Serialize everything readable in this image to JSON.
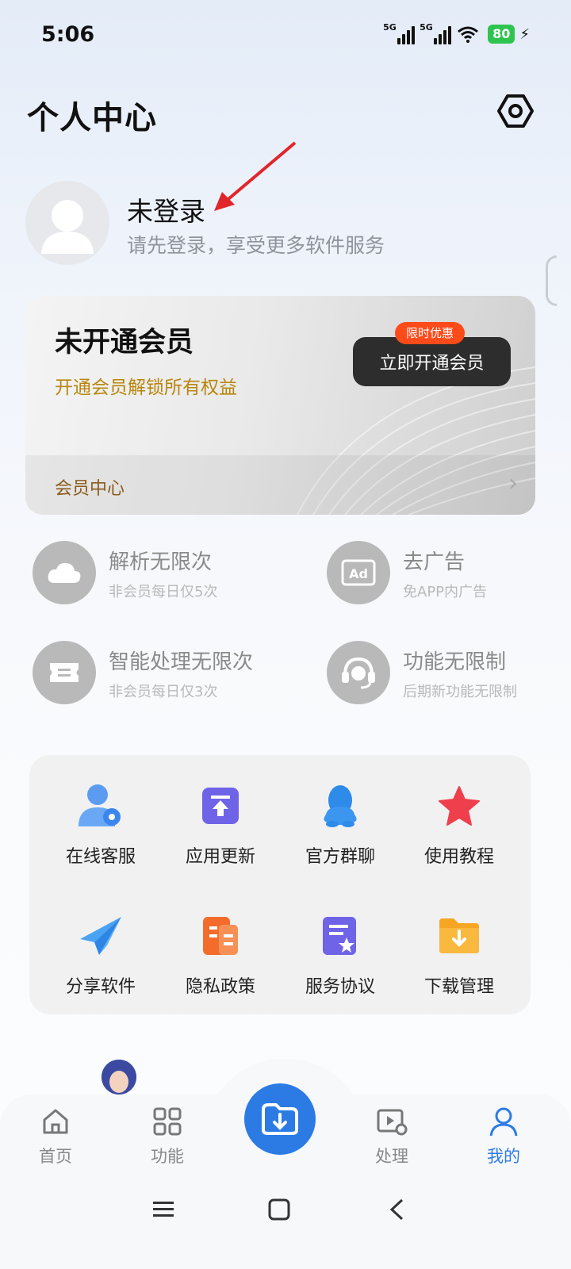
{
  "status": {
    "time": "5:06",
    "net1": "5G",
    "net2": "5G",
    "battery": "80"
  },
  "header": {
    "title": "个人中心"
  },
  "profile": {
    "name": "未登录",
    "subtitle": "请先登录，享受更多软件服务"
  },
  "vip": {
    "title": "未开通会员",
    "subtitle": "开通会员解锁所有权益",
    "badge": "限时优惠",
    "button": "立即开通会员",
    "footer": "会员中心"
  },
  "benefits": [
    {
      "title": "解析无限次",
      "sub": "非会员每日仅5次",
      "icon": "cloud-icon"
    },
    {
      "title": "去广告",
      "sub": "免APP内广告",
      "icon": "ad-icon"
    },
    {
      "title": "智能处理无限次",
      "sub": "非会员每日仅3次",
      "icon": "ticket-icon"
    },
    {
      "title": "功能无限制",
      "sub": "后期新功能无限制",
      "icon": "headset-icon"
    }
  ],
  "tools": [
    {
      "label": "在线客服",
      "icon": "customer-service-icon"
    },
    {
      "label": "应用更新",
      "icon": "app-update-icon"
    },
    {
      "label": "官方群聊",
      "icon": "qq-icon"
    },
    {
      "label": "使用教程",
      "icon": "star-icon"
    },
    {
      "label": "分享软件",
      "icon": "paper-plane-icon"
    },
    {
      "label": "隐私政策",
      "icon": "document-icon"
    },
    {
      "label": "服务协议",
      "icon": "agreement-icon"
    },
    {
      "label": "下载管理",
      "icon": "download-folder-icon"
    }
  ],
  "nav": [
    {
      "label": "首页",
      "icon": "home-icon"
    },
    {
      "label": "功能",
      "icon": "grid-icon"
    },
    {
      "label": "处理",
      "icon": "video-process-icon"
    },
    {
      "label": "我的",
      "icon": "user-icon",
      "active": true
    }
  ],
  "colors": {
    "accent": "#2c7be5",
    "badge": "#ff4a1a",
    "gold": "#b8860b"
  }
}
